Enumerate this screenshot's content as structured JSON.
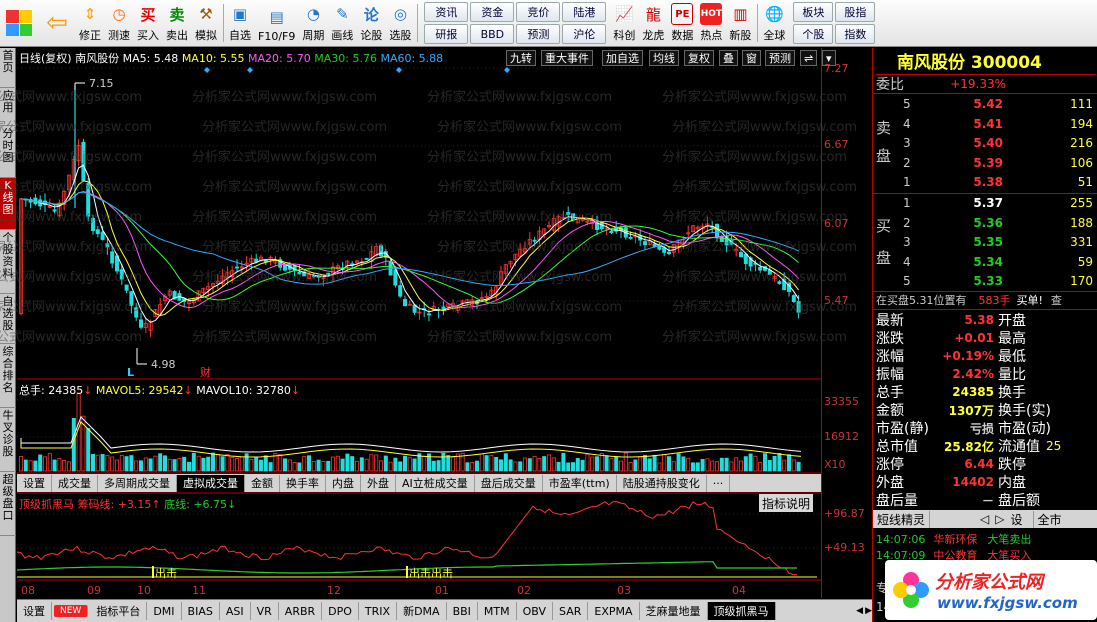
{
  "toolbar": {
    "left": [
      {
        "label": "",
        "icon": "grid-icon"
      },
      {
        "label": "",
        "icon": "back-arrow-icon"
      },
      {
        "label": "修正",
        "icon": "up-down-arrows-icon"
      },
      {
        "label": "测速",
        "icon": "clock-icon"
      },
      {
        "label": "买入",
        "icon": "buy-icon",
        "glyph": "买"
      },
      {
        "label": "卖出",
        "icon": "sell-icon",
        "glyph": "卖"
      },
      {
        "label": "模拟",
        "icon": "hammer-icon"
      },
      {
        "label": "自选",
        "icon": "folder-icon"
      },
      {
        "label": "F10/F9",
        "icon": "f10-icon"
      },
      {
        "label": "周期",
        "icon": "cycle-icon"
      },
      {
        "label": "画线",
        "icon": "pencil-icon"
      },
      {
        "label": "论股",
        "icon": "forum-icon"
      },
      {
        "label": "选股",
        "icon": "select-icon"
      }
    ],
    "grid_buttons": [
      "资讯",
      "资金",
      "竞价",
      "陆港",
      "研报",
      "BBD",
      "预测",
      "沪伦"
    ],
    "right": [
      {
        "label": "科创",
        "icon": "chart-icon"
      },
      {
        "label": "龙虎",
        "icon": "dragon-icon"
      },
      {
        "label": "数据",
        "icon": "pe-icon",
        "glyph": "PE"
      },
      {
        "label": "热点",
        "icon": "hot-icon",
        "glyph": "HOT"
      },
      {
        "label": "新股",
        "icon": "new-stock-icon"
      },
      {
        "label": "全球",
        "icon": "globe-icon"
      }
    ],
    "right_buttons": [
      "板块",
      "股指",
      "个股",
      "指数"
    ]
  },
  "left_tabs": [
    "首页",
    "应用",
    "分时图",
    "K线图",
    "个股资料",
    "自选股",
    "综合排名",
    "牛叉诊股",
    "超级盘口"
  ],
  "chart_header": {
    "text": "日线(复权) 南风股份",
    "ma5": "MA5: 5.48",
    "ma10": "MA10: 5.55",
    "ma20": "MA20: 5.70",
    "ma30": "MA30: 5.76",
    "ma60": "MA60: 5.88"
  },
  "chart_buttons": [
    "九转",
    "重大事件",
    "加自选",
    "均线",
    "复权",
    "叠",
    "窗",
    "预测"
  ],
  "price_axis": [
    "7.27",
    "6.67",
    "6.07",
    "5.47"
  ],
  "annotations": {
    "high": "7.15",
    "low": "4.98",
    "fin": "财",
    "low_mark": "L"
  },
  "volume_header": {
    "vol": "总手: 24385",
    "mavol5": "MAVOL5: 29542",
    "mavol10": "MAVOL10: 32780"
  },
  "volume_axis": [
    "33355",
    "16912",
    "X10"
  ],
  "period_tabs": [
    "设置",
    "成交量",
    "多周期成交量",
    "虚拟成交量",
    "金额",
    "换手率",
    "内盘",
    "外盘",
    "AI立桩成交量",
    "盘后成交量",
    "市盈率(ttm)",
    "陆股通持股变化",
    "···"
  ],
  "indicator_header": {
    "name": "顶级抓黑马",
    "line1": "筹码线: +3.15",
    "line2": "底线: +6.75",
    "help": "指标说明"
  },
  "indicator_axis": [
    "+96.87",
    "+49.13"
  ],
  "signals": [
    "出击",
    "出击出击"
  ],
  "x_axis": [
    "08",
    "09",
    "10",
    "11",
    "12",
    "01",
    "02",
    "03",
    "04"
  ],
  "bottom_indicators": [
    "设置",
    "NEW",
    "指标平台",
    "DMI",
    "BIAS",
    "ASI",
    "VR",
    "ARBR",
    "DPO",
    "TRIX",
    "新DMA",
    "BBI",
    "MTM",
    "OBV",
    "SAR",
    "EXPMA",
    "芝麻量地量",
    "顶级抓黑马"
  ],
  "watermark": "分析家公式网www.fxjgsw.com",
  "quote": {
    "title": "南风股份 300004",
    "wei_bi_label": "委比",
    "wei_bi": "+19.33%",
    "sell_label": [
      "卖",
      "盘"
    ],
    "buy_label": [
      "买",
      "盘"
    ],
    "sells": [
      {
        "n": "5",
        "price": "5.42",
        "vol": "111"
      },
      {
        "n": "4",
        "price": "5.41",
        "vol": "194"
      },
      {
        "n": "3",
        "price": "5.40",
        "vol": "216"
      },
      {
        "n": "2",
        "price": "5.39",
        "vol": "106"
      },
      {
        "n": "1",
        "price": "5.38",
        "vol": "51"
      }
    ],
    "buys": [
      {
        "n": "1",
        "price": "5.37",
        "vol": "255"
      },
      {
        "n": "2",
        "price": "5.36",
        "vol": "188"
      },
      {
        "n": "3",
        "price": "5.35",
        "vol": "331"
      },
      {
        "n": "4",
        "price": "5.34",
        "vol": "59"
      },
      {
        "n": "5",
        "price": "5.33",
        "vol": "170"
      }
    ],
    "notice": "在买盘5.31位置有",
    "notice_vol": "583手",
    "notice_tag": "买单!",
    "notice_more": "查",
    "stats": [
      {
        "l": "最新",
        "v": "5.38",
        "r": "开盘",
        "c": "red"
      },
      {
        "l": "涨跌",
        "v": "+0.01",
        "r": "最高",
        "c": "red"
      },
      {
        "l": "涨幅",
        "v": "+0.19%",
        "r": "最低",
        "c": "red"
      },
      {
        "l": "振幅",
        "v": "2.42%",
        "r": "量比",
        "c": "red"
      },
      {
        "l": "总手",
        "v": "24385",
        "r": "换手",
        "c": "yel"
      },
      {
        "l": "金额",
        "v": "1307万",
        "r": "换手(实)",
        "c": "yel"
      },
      {
        "l": "市盈(静)",
        "v": "亏损",
        "r": "市盈(动)",
        "c": "gray"
      },
      {
        "l": "总市值",
        "v": "25.82亿",
        "r": "流通值",
        "c": "yel",
        "v2": "25"
      },
      {
        "l": "涨停",
        "v": "6.44",
        "r": "跌停",
        "c": "red"
      },
      {
        "l": "外盘",
        "v": "14402",
        "r": "内盘",
        "c": "red"
      },
      {
        "l": "盘后量",
        "v": "－",
        "r": "盘后额",
        "c": "gray"
      }
    ],
    "tabs": [
      "短线精灵",
      "设",
      "全市"
    ],
    "news": [
      {
        "t": "14:07:06",
        "name": "华新环保",
        "act": "大笔卖出",
        "c": "green"
      },
      {
        "t": "14:07:09",
        "name": "中公教育",
        "act": "大笔买入",
        "c": "red"
      }
    ],
    "bottom_text": "专",
    "bottom_text2": "14"
  },
  "logo": {
    "cn": "分析家公式网",
    "url": "www.fxjgsw.com"
  },
  "colors": {
    "up": "#ff3333",
    "down": "#22dddd",
    "ma5": "#ffffff",
    "ma10": "#ffff33",
    "ma20": "#ff55ff",
    "ma30": "#33ff33",
    "ma60": "#33aaff"
  }
}
